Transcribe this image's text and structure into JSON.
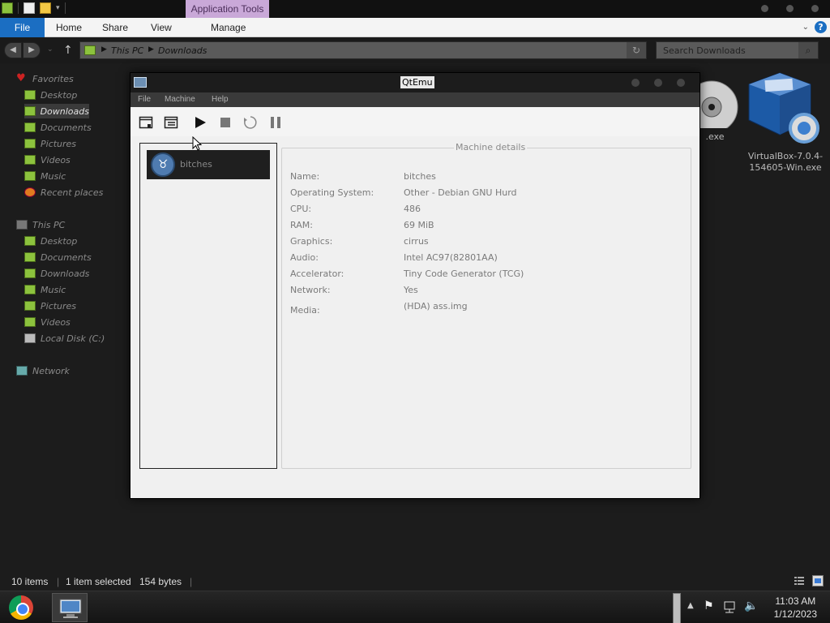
{
  "explorer": {
    "ribbon": {
      "contextual_group": "Application Tools",
      "tabs": [
        "File",
        "Home",
        "Share",
        "View",
        "Manage"
      ]
    },
    "address": {
      "segments": [
        "This PC",
        "Downloads"
      ]
    },
    "search_placeholder": "Search Downloads",
    "nav": {
      "favorites_header": "Favorites",
      "favorites": [
        "Desktop",
        "Downloads",
        "Documents",
        "Pictures",
        "Videos",
        "Music",
        "Recent places"
      ],
      "thispc_header": "This PC",
      "thispc": [
        "Desktop",
        "Documents",
        "Downloads",
        "Music",
        "Pictures",
        "Videos",
        "Local Disk (C:)"
      ],
      "network": "Network"
    },
    "status": {
      "item_count": "10 items",
      "selection": "1 item selected",
      "size": "154 bytes"
    }
  },
  "desktop_icons": {
    "disc_label": ".exe",
    "vbox_label_line1": "VirtualBox-7.0.4-",
    "vbox_label_line2": "154605-Win.exe"
  },
  "qtemu": {
    "title": "QtEmu",
    "menu": [
      "File",
      "Machine",
      "Help"
    ],
    "vm_list": [
      {
        "name": "bitches"
      }
    ],
    "details_title": "Machine details",
    "details": [
      {
        "label": "Name:",
        "value": "bitches"
      },
      {
        "label": "Operating System:",
        "value": "Other - Debian GNU Hurd"
      },
      {
        "label": "CPU:",
        "value": "486"
      },
      {
        "label": "RAM:",
        "value": "69 MiB"
      },
      {
        "label": "Graphics:",
        "value": "cirrus"
      },
      {
        "label": "Audio:",
        "value": "Intel AC97(82801AA)"
      },
      {
        "label": "Accelerator:",
        "value": "Tiny Code Generator (TCG)"
      },
      {
        "label": "Network:",
        "value": "Yes"
      },
      {
        "label": "Media:",
        "value": "(HDA) ass.img"
      }
    ]
  },
  "taskbar": {
    "time": "11:03 AM",
    "date": "1/12/2023"
  }
}
